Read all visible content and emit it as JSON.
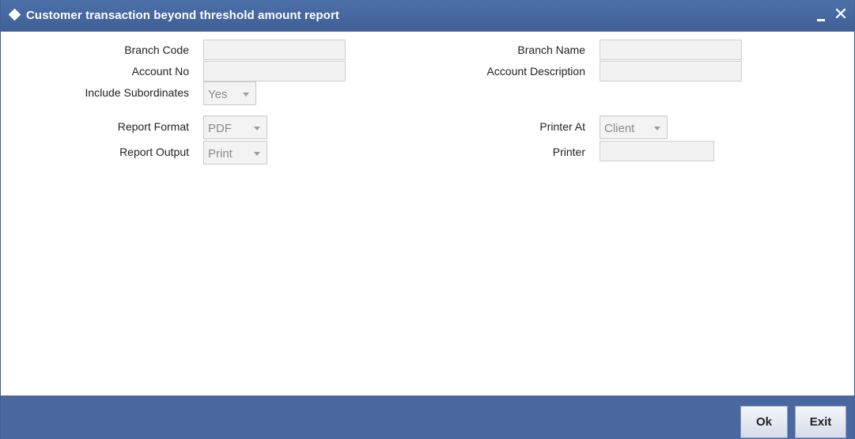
{
  "window": {
    "title": "Customer transaction beyond threshold amount report",
    "close_symbol": "✕"
  },
  "form": {
    "branch_code_label": "Branch Code",
    "branch_code_value": "",
    "branch_name_label": "Branch Name",
    "branch_name_value": "",
    "account_no_label": "Account No",
    "account_no_value": "",
    "account_description_label": "Account Description",
    "account_description_value": "",
    "include_subordinates_label": "Include Subordinates",
    "include_subordinates_value": "Yes",
    "report_format_label": "Report Format",
    "report_format_value": "PDF",
    "printer_at_label": "Printer At",
    "printer_at_value": "Client",
    "report_output_label": "Report Output",
    "report_output_value": "Print",
    "printer_label": "Printer",
    "printer_value": ""
  },
  "footer": {
    "ok_label": "Ok",
    "exit_label": "Exit"
  },
  "colors": {
    "titlebar": "#4d6fa8",
    "footer": "#4a67a0",
    "field_bg": "#f2f2f2"
  }
}
